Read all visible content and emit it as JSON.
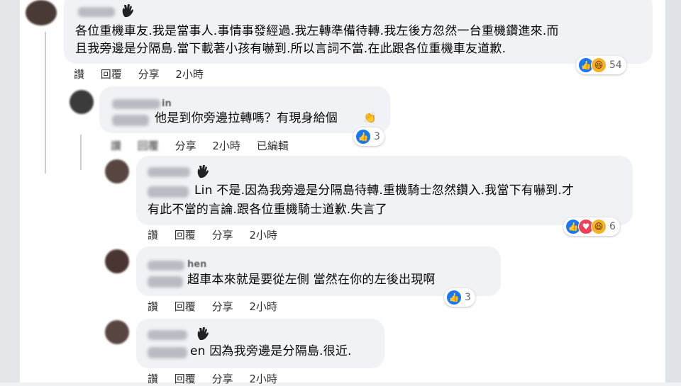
{
  "comments": [
    {
      "text_line1": "各位重機車友.我是當事人.事情事發經過.我左轉準備待轉.我左後方忽然一台重機鑽進來.而",
      "text_line2": "且我旁邊是分隔島.當下載著小孩有嚇到.所以言詞不當.在此跟各位重機車友道歉.",
      "actions": [
        "讚",
        "回覆",
        "分享",
        "2小時"
      ],
      "reaction_count": "54",
      "reactions": [
        "like-icon",
        "haha-icon"
      ]
    },
    {
      "name": "in",
      "text": "他是到你旁邊拉轉嗎？有現身給個",
      "actions": [
        "讚",
        "回覆",
        "分享",
        "2小時",
        "已編輯"
      ],
      "reaction_count": "3",
      "reactions": [
        "like-icon"
      ]
    },
    {
      "text_line1": "Lin 不是.因為我旁邊是分隔島待轉.重機騎士忽然鑽入.我當下有嚇到.才",
      "text_line2": "有此不當的言論.跟各位重機騎士道歉.失言了",
      "actions": [
        "讚",
        "回覆",
        "分享",
        "2小時"
      ],
      "reaction_count": "6",
      "reactions": [
        "like-icon",
        "love-icon",
        "haha-icon"
      ]
    },
    {
      "name": "hen",
      "text": "超車本來就是要從左側 當然在你的左後出現啊",
      "actions": [
        "讚",
        "回覆",
        "分享",
        "2小時"
      ],
      "reaction_count": "3",
      "reactions": [
        "like-icon"
      ]
    },
    {
      "text": "en 因為我旁邊是分隔島.很近.",
      "actions": [
        "讚",
        "回覆",
        "分享",
        "2小時"
      ]
    }
  ]
}
